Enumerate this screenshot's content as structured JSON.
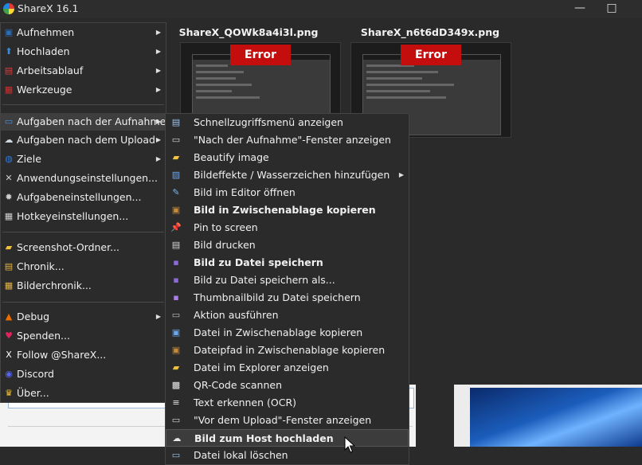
{
  "window": {
    "title": "ShareX 16.1"
  },
  "thumbnails": [
    {
      "name": "ShareX_QOWk8a4i3l.png",
      "error": "Error"
    },
    {
      "name": "ShareX_n6t6dD349x.png",
      "error": "Error"
    }
  ],
  "main_menu": [
    {
      "label": "Aufnehmen",
      "icon": "camera-icon",
      "color": "#2a6ebb",
      "arrow": true
    },
    {
      "label": "Hochladen",
      "icon": "upload-arrow-icon",
      "color": "#3d8be0",
      "arrow": true
    },
    {
      "label": "Arbeitsablauf",
      "icon": "workflow-icon",
      "color": "#e23b3b",
      "arrow": true
    },
    {
      "label": "Werkzeuge",
      "icon": "toolbox-icon",
      "color": "#d42c2c",
      "arrow": true
    },
    {
      "label": "Aufgaben nach der Aufnahme",
      "icon": "monitor-icon",
      "color": "#4a90d9",
      "arrow": true
    },
    {
      "label": "Aufgaben nach dem Upload",
      "icon": "cloud-upload-icon",
      "color": "#cfd8e3",
      "arrow": true
    },
    {
      "label": "Ziele",
      "icon": "globe-upload-icon",
      "color": "#2f7ad8",
      "arrow": true
    },
    {
      "label": "Anwendungseinstellungen...",
      "icon": "wrench-screwdriver-icon",
      "color": "#d0d0d0",
      "arrow": false
    },
    {
      "label": "Aufgabeneinstellungen...",
      "icon": "gear-icon",
      "color": "#d0d0d0",
      "arrow": false
    },
    {
      "label": "Hotkeyeinstellungen...",
      "icon": "keyboard-icon",
      "color": "#d0d0d0",
      "arrow": false
    },
    {
      "label": "Screenshot-Ordner...",
      "icon": "folder-icon",
      "color": "#f0c03c",
      "arrow": false
    },
    {
      "label": "Chronik...",
      "icon": "history-window-icon",
      "color": "#e6b441",
      "arrow": false
    },
    {
      "label": "Bilderchronik...",
      "icon": "image-grid-icon",
      "color": "#e6b441",
      "arrow": false
    },
    {
      "label": "Debug",
      "icon": "traffic-cone-icon",
      "color": "#ef6c00",
      "arrow": true
    },
    {
      "label": "Spenden...",
      "icon": "heart-icon",
      "color": "#e0245e",
      "arrow": false
    },
    {
      "label": "Follow @ShareX...",
      "icon": "x-logo-icon",
      "color": "#ffffff",
      "arrow": false
    },
    {
      "label": "Discord",
      "icon": "discord-icon",
      "color": "#5865f2",
      "arrow": false
    },
    {
      "label": "Über...",
      "icon": "crown-icon",
      "color": "#f2c230",
      "arrow": false
    }
  ],
  "sub_menu": [
    {
      "label": "Schnellzugriffsmenü anzeigen",
      "icon": "quick-menu-icon",
      "color": "#9ec5ee",
      "bold": false,
      "arrow": false
    },
    {
      "label": "\"Nach der Aufnahme\"-Fenster anzeigen",
      "icon": "window-icon",
      "color": "#cfd8e3",
      "bold": false,
      "arrow": false
    },
    {
      "label": "Beautify image",
      "icon": "beautify-image-icon",
      "color": "#f5c242",
      "bold": false,
      "arrow": false
    },
    {
      "label": "Bildeffekte / Wasserzeichen hinzufügen",
      "icon": "image-effects-icon",
      "color": "#6aa7e8",
      "bold": false,
      "arrow": true
    },
    {
      "label": "Bild im Editor öffnen",
      "icon": "image-edit-icon",
      "color": "#78b6ef",
      "bold": false,
      "arrow": false
    },
    {
      "label": "Bild in Zwischenablage kopieren",
      "icon": "clipboard-image-icon",
      "color": "#c28a3a",
      "bold": true,
      "arrow": false
    },
    {
      "label": "Pin to screen",
      "icon": "pin-icon",
      "color": "#e23b3b",
      "bold": false,
      "arrow": false
    },
    {
      "label": "Bild drucken",
      "icon": "printer-icon",
      "color": "#d8d8d8",
      "bold": false,
      "arrow": false
    },
    {
      "label": "Bild zu Datei speichern",
      "icon": "save-disk-icon",
      "color": "#8f6ad6",
      "bold": true,
      "arrow": false
    },
    {
      "label": "Bild zu Datei speichern als...",
      "icon": "save-as-icon",
      "color": "#8f6ad6",
      "bold": false,
      "arrow": false
    },
    {
      "label": "Thumbnailbild zu Datei speichern",
      "icon": "thumbnail-save-icon",
      "color": "#a97ee8",
      "bold": false,
      "arrow": false
    },
    {
      "label": "Aktion ausführen",
      "icon": "terminal-icon",
      "color": "#bdbdbd",
      "bold": false,
      "arrow": false
    },
    {
      "label": "Datei in Zwischenablage kopieren",
      "icon": "clipboard-file-icon",
      "color": "#6aa7e8",
      "bold": false,
      "arrow": false
    },
    {
      "label": "Dateipfad in Zwischenablage kopieren",
      "icon": "clipboard-path-icon",
      "color": "#c28a3a",
      "bold": false,
      "arrow": false
    },
    {
      "label": "Datei im Explorer anzeigen",
      "icon": "folder-open-icon",
      "color": "#f0c03c",
      "bold": false,
      "arrow": false
    },
    {
      "label": "QR-Code scannen",
      "icon": "qr-code-icon",
      "color": "#e8e8e8",
      "bold": false,
      "arrow": false
    },
    {
      "label": "Text erkennen (OCR)",
      "icon": "ocr-text-icon",
      "color": "#e8e8e8",
      "bold": false,
      "arrow": false
    },
    {
      "label": "\"Vor dem Upload\"-Fenster anzeigen",
      "icon": "before-upload-window-icon",
      "color": "#cfd8e3",
      "bold": false,
      "arrow": false
    },
    {
      "label": "Bild zum Host hochladen",
      "icon": "cloud-upload-icon",
      "color": "#e8e8e8",
      "bold": true,
      "arrow": false
    },
    {
      "label": "Datei lokal löschen",
      "icon": "delete-file-icon",
      "color": "#9ec5ee",
      "bold": false,
      "arrow": false
    }
  ]
}
